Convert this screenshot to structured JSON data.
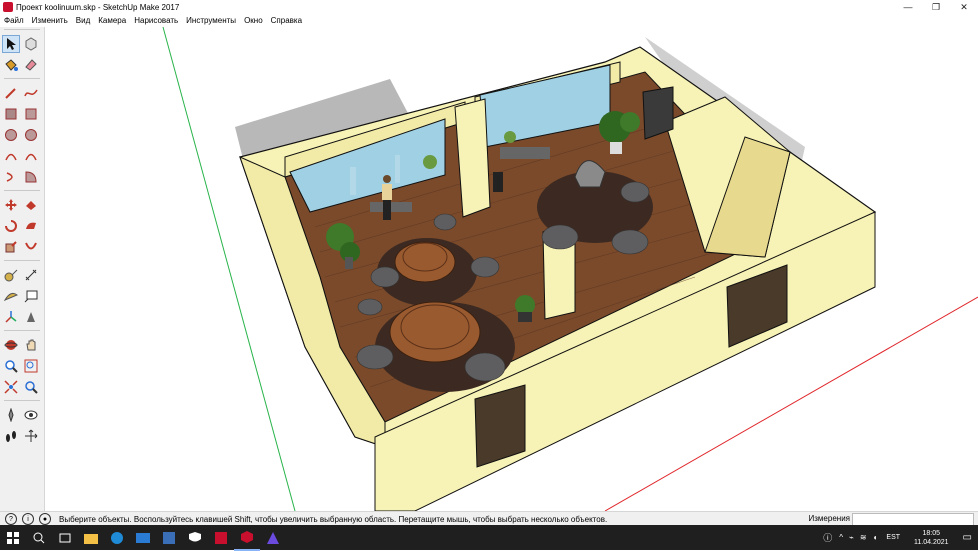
{
  "window": {
    "title": "Проект koolinuum.skp - SketchUp Make 2017",
    "minimize": "—",
    "maximize": "❐",
    "close": "✕"
  },
  "menu": [
    "Файл",
    "Изменить",
    "Вид",
    "Камера",
    "Нарисовать",
    "Инструменты",
    "Окно",
    "Справка"
  ],
  "tools": [
    [
      "select-icon",
      "component-icon"
    ],
    [
      "paint-bucket-icon",
      "eraser-icon"
    ],
    [
      "pencil-line-icon",
      "freehand-icon"
    ],
    [
      "rectangle-icon",
      "rotated-rectangle-icon"
    ],
    [
      "circle-icon",
      "polygon-icon"
    ],
    [
      "arc-icon",
      "two-point-arc-icon"
    ],
    [
      "three-point-arc-icon",
      "pie-icon"
    ],
    [
      "move-icon",
      "push-pull-icon"
    ],
    [
      "rotate-icon",
      "follow-me-icon"
    ],
    [
      "scale-icon",
      "offset-icon"
    ],
    [
      "tape-measure-icon",
      "dimension-icon"
    ],
    [
      "protractor-icon",
      "text-icon"
    ],
    [
      "axes-icon",
      "3d-text-icon"
    ],
    [
      "orbit-icon",
      "pan-icon"
    ],
    [
      "zoom-icon",
      "zoom-window-icon"
    ],
    [
      "zoom-extents-icon",
      "previous-view-icon"
    ],
    [
      "position-camera-icon",
      "look-around-icon"
    ],
    [
      "walk-icon",
      "section-plane-icon"
    ]
  ],
  "status": {
    "hint": "Выберите объекты. Воспользуйтесь клавишей Shift, чтобы увеличить выбранную область. Перетащите мышь, чтобы выбрать несколько объектов.",
    "measurements_label": "Измерения",
    "measurements_value": ""
  },
  "taskbar": {
    "apps": [
      "start-icon",
      "search-icon",
      "task-view-icon",
      "file-explorer-icon",
      "edge-icon",
      "mail-icon",
      "photos-icon",
      "security-icon",
      "sketchup-icon",
      "sketchup-2-icon",
      "browser-icon"
    ],
    "lang": "EST",
    "time": "18:05",
    "date": "11.04.2021"
  },
  "colors": {
    "wall": "#f7f2b5",
    "floor": "#7a4a2b",
    "rug": "#3c2a22",
    "table": "#9a5a2f",
    "chair": "#5e5e60",
    "glass": "#9fd0e4",
    "door": "#4a3a2a",
    "axis_green": "#29b34a",
    "axis_red": "#e0262b"
  }
}
